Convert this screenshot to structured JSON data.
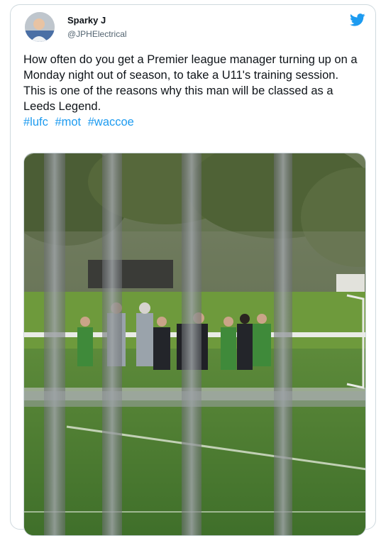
{
  "tweet": {
    "author_name": "Sparky J",
    "author_handle": "@JPHElectrical",
    "text_line_1": "How often do you get a Premier league manager turning up on a Monday night out of season, to take a U11's training session.",
    "text_line_2": "This is one of the reasons why this man will be classed as a Leeds Legend.",
    "hashtags": [
      "#lufc",
      "#mot",
      "#waccoe"
    ]
  },
  "icons": {
    "brand": "twitter-bird-icon"
  },
  "colors": {
    "link": "#1d9bf0",
    "text": "#0f1419",
    "secondary_text": "#536471",
    "border": "#cfd9de"
  }
}
